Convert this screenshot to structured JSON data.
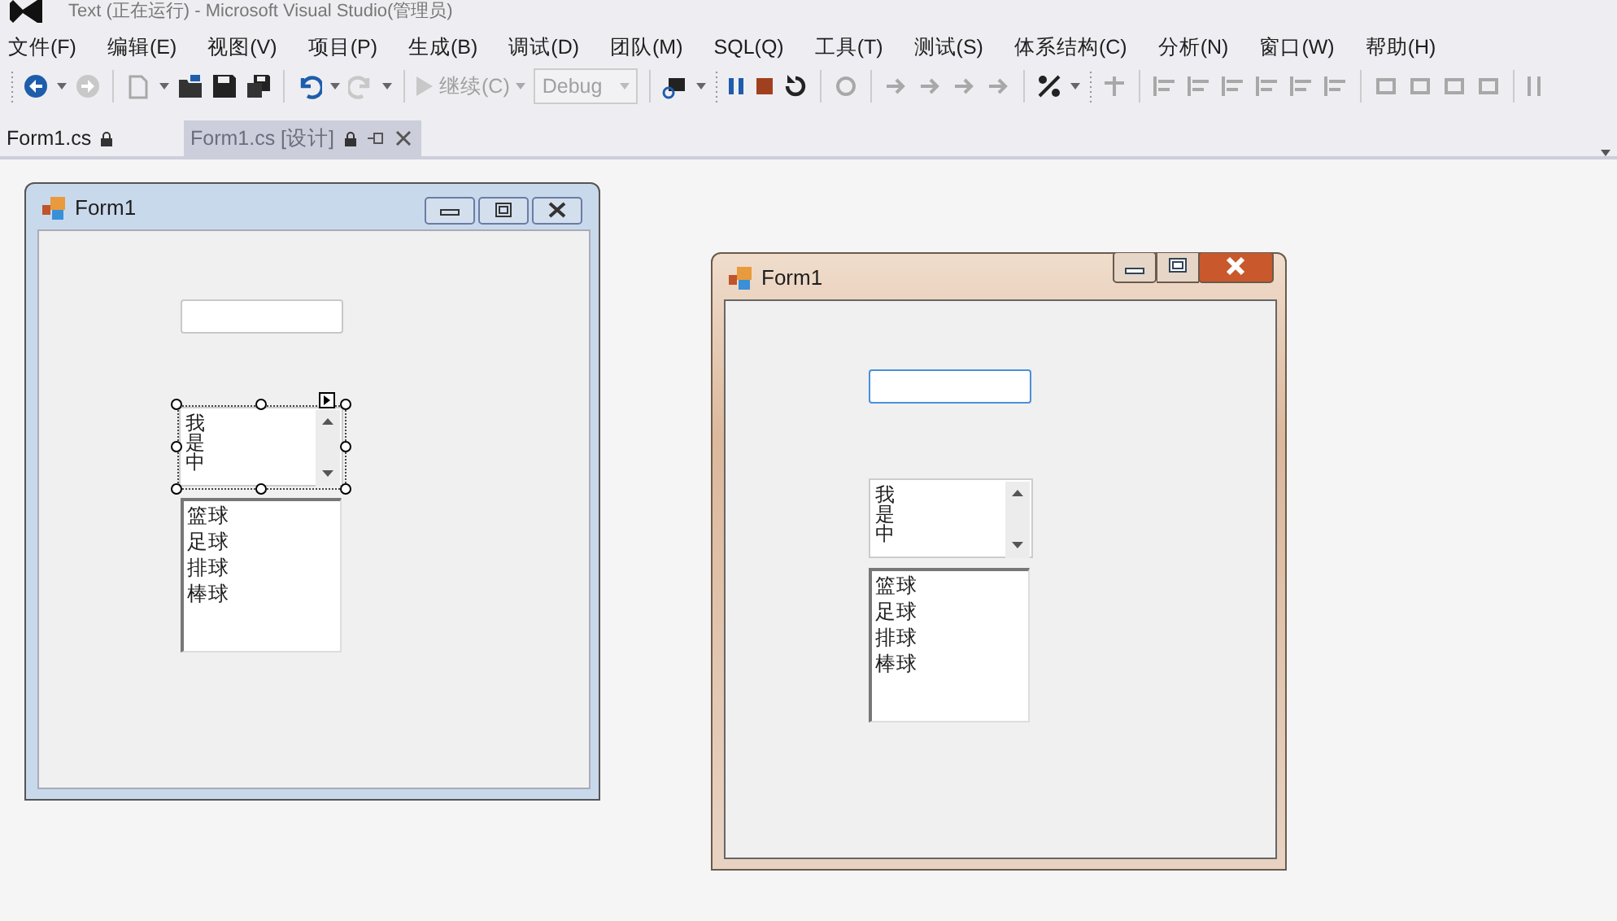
{
  "window": {
    "title": "Text (正在运行) - Microsoft Visual Studio(管理员)"
  },
  "menu": [
    {
      "label": "文件(F)"
    },
    {
      "label": "编辑(E)"
    },
    {
      "label": "视图(V)"
    },
    {
      "label": "项目(P)"
    },
    {
      "label": "生成(B)"
    },
    {
      "label": "调试(D)"
    },
    {
      "label": "团队(M)"
    },
    {
      "label": "SQL(Q)"
    },
    {
      "label": "工具(T)"
    },
    {
      "label": "测试(S)"
    },
    {
      "label": "体系结构(C)"
    },
    {
      "label": "分析(N)"
    },
    {
      "label": "窗口(W)"
    },
    {
      "label": "帮助(H)"
    }
  ],
  "toolbar": {
    "continue_label": "继续(C)",
    "config_combo": {
      "value": "Debug",
      "disabled": true
    }
  },
  "tabs": [
    {
      "label": "Form1.cs",
      "selected": false
    },
    {
      "label": "Form1.cs [设计]",
      "selected": true
    }
  ],
  "forms": [
    {
      "kind": "designer",
      "title": "Form1",
      "textbox": {
        "focused": false
      },
      "multiline": {
        "lines": [
          "我",
          "是",
          "中"
        ],
        "selected": true
      },
      "listbox": {
        "items": [
          "篮球",
          "足球",
          "排球",
          "棒球"
        ]
      }
    },
    {
      "kind": "running",
      "title": "Form1",
      "textbox": {
        "focused": true
      },
      "multiline": {
        "lines": [
          "我",
          "是",
          "中"
        ],
        "selected": false
      },
      "listbox": {
        "items": [
          "篮球",
          "足球",
          "排球",
          "棒球"
        ]
      }
    }
  ]
}
